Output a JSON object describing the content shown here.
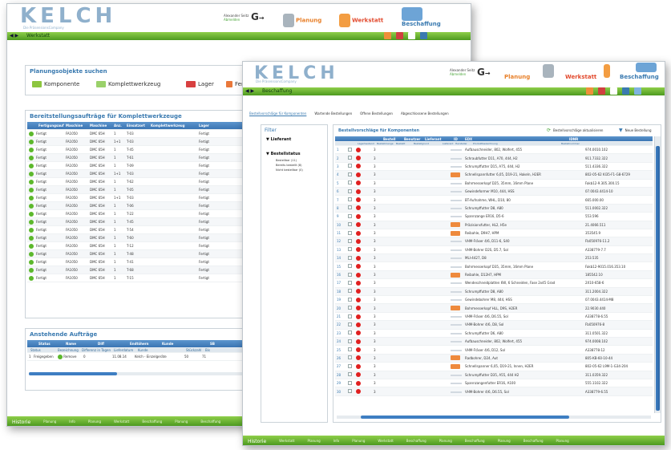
{
  "brand": {
    "logo": "KELCH",
    "tagline": "Die PräsensionsCompany"
  },
  "back_window": {
    "user": {
      "name": "Alexander Seitz",
      "sub": "Abmelden"
    },
    "modules": [
      "Planung",
      "Werkstatt",
      "Beschaffung"
    ],
    "breadcrumb": "Werkstatt",
    "search_panel": {
      "title": "Planungsobjekte suchen",
      "buttons": [
        "Komponente",
        "Komplettwerkzeug",
        "Lager",
        "Fert"
      ]
    },
    "orders_panel": {
      "title": "Bereitstellungsaufträge für Komplettwerkzeuge",
      "columns": [
        "Fertigungsauftrag",
        "Maschine",
        "Maschine",
        "Anz.",
        "Einsatzort",
        "Komplettwerkzeug",
        "Lager"
      ],
      "rows": [
        [
          "Fertigt",
          "FA1050",
          "DMC 65H",
          "1",
          "T-03",
          "",
          "Fertigt"
        ],
        [
          "Fertigt",
          "FA1050",
          "DMC 65H",
          "1+1",
          "T-03",
          "",
          "Fertigt"
        ],
        [
          "Fertigt",
          "FA1050",
          "DMC 65H",
          "1",
          "T-45",
          "",
          "Fertigt"
        ],
        [
          "Fertigt",
          "FA1050",
          "DMC 65H",
          "1",
          "T-61",
          "",
          "Fertigt"
        ],
        [
          "Fertigt",
          "FA1050",
          "DMC 65H",
          "1",
          "T-09",
          "",
          "Fertigt"
        ],
        [
          "Fertigt",
          "FA1050",
          "DMC 65H",
          "1+1",
          "T-03",
          "",
          "Fertigt"
        ],
        [
          "Fertigt",
          "FA1050",
          "DMC 65H",
          "1",
          "T-62",
          "",
          "Fertigt"
        ],
        [
          "Fertigt",
          "FA1050",
          "DMC 65H",
          "1",
          "T-05",
          "",
          "Fertigt"
        ],
        [
          "Fertigt",
          "FA1050",
          "DMC 65H",
          "1+1",
          "T-03",
          "",
          "Fertigt"
        ],
        [
          "Fertigt",
          "FA1050",
          "DMC 65H",
          "1",
          "T-06",
          "",
          "Fertigt"
        ],
        [
          "Fertigt",
          "FA1050",
          "DMC 65H",
          "1",
          "T-22",
          "",
          "Fertigt"
        ],
        [
          "Fertigt",
          "FA1050",
          "DMC 65H",
          "1",
          "T-45",
          "",
          "Fertigt"
        ],
        [
          "Fertigt",
          "FA1050",
          "DMC 65H",
          "1",
          "T-54",
          "",
          "Fertigt"
        ],
        [
          "Fertigt",
          "FA1050",
          "DMC 65H",
          "1",
          "T-60",
          "",
          "Fertigt"
        ],
        [
          "Fertigt",
          "FA1050",
          "DMC 65H",
          "1",
          "T-12",
          "",
          "Fertigt"
        ],
        [
          "Fertigt",
          "FA1050",
          "DMC 65H",
          "1",
          "T-48",
          "",
          "Fertigt"
        ],
        [
          "Fertigt",
          "FA1050",
          "DMC 65H",
          "1",
          "T-41",
          "",
          "Fertigt"
        ],
        [
          "Fertigt",
          "FA1050",
          "DMC 65H",
          "1",
          "T-68",
          "",
          "Fertigt"
        ],
        [
          "Fertigt",
          "FA1050",
          "DMC 65H",
          "1",
          "T-15",
          "",
          "Fertigt"
        ]
      ]
    },
    "pending_panel": {
      "title": "Anstehende Aufträge",
      "columns": [
        "Status",
        "Name",
        "Diff",
        "Endtöhern",
        "Kunde",
        "SB"
      ],
      "subcolumns": [
        "Status",
        "Bezeichnung",
        "Differenz in Tagen",
        "Lieferdatum",
        "Kunde",
        "Stückzahl",
        "Bis"
      ],
      "row": [
        "1",
        "Freigegeben",
        "Remove",
        "0",
        "11.08.14",
        "Kelch - Einzelgeräte",
        "50",
        "71"
      ]
    },
    "footer": [
      "Historie",
      "Planung",
      "Info",
      "Planung",
      "Werkstatt",
      "Beschaffung",
      "Planung",
      "Beschaffung"
    ]
  },
  "front_window": {
    "user": {
      "name": "Alexander Seitz",
      "sub": "Abmelden"
    },
    "modules": [
      "Planung",
      "Werkstatt",
      "Beschaffung"
    ],
    "breadcrumb": "Beschaffung",
    "tabs": [
      "Bestellvorschläge für Komponenten",
      "Wartende Bestellungen",
      "Offene Bestellungen",
      "Abgeschlossene Bestellungen"
    ],
    "filter": {
      "title": "Filter",
      "group1": "Lieferant",
      "group2": "Bestellstatus",
      "options": [
        "Bestellbar (11)",
        "Bereits bestellt (8)",
        "Nicht bestellbar (0)"
      ]
    },
    "table": {
      "title": "Bestellvorschläge für Komponenten",
      "action1": "Bestellvorschläge aktualisieren",
      "action2": "Neue Bestellung",
      "columns": [
        "Bestell",
        "Benutzer",
        "Lieferant",
        "ID",
        "EDX",
        "IDNR"
      ],
      "subcolumns": [
        "Lagerbestand",
        "Bestellmenge",
        "Bestellt",
        "Bestellgrund",
        "Lieferant",
        "Hersteller",
        "Produktbezeichnung",
        "Bestellnummer"
      ],
      "rows": [
        {
          "n": "1",
          "qty": "3",
          "desc": "Aufbauschneider, 802, Wolfert, 455",
          "nr": "974.0010.102",
          "badge": false
        },
        {
          "n": "2",
          "qty": "3",
          "desc": "Schraubfutter D11, A70, 444, H2",
          "nr": "911.7332.322",
          "badge": false
        },
        {
          "n": "3",
          "qty": "3",
          "desc": "Schrumpffutter D15, A75, 444, H2",
          "nr": "511.4336.322",
          "badge": false
        },
        {
          "n": "4",
          "qty": "3",
          "desc": "Schnellspannfutter 6,05, D19-21, Hakeln, H2ER",
          "nr": "802-05-62 Kl35-F1-G8-6729",
          "badge": true
        },
        {
          "n": "5",
          "qty": "3",
          "desc": "Bohrmesserkopf D25, 35mm, 16mm Plane",
          "nr": "Fakb12-9.305.300.15",
          "badge": false
        },
        {
          "n": "6",
          "qty": "3",
          "desc": "Gewindeformer M10, 444, HSS",
          "nr": "07.0043.4414-10",
          "badge": false
        },
        {
          "n": "7",
          "qty": "3",
          "desc": "BT-Aufnahme, WHL, D10, 80",
          "nr": "665.000.00",
          "badge": false
        },
        {
          "n": "8",
          "qty": "3",
          "desc": "Schrumpffutter D8, A80",
          "nr": "511.0002.322",
          "badge": false
        },
        {
          "n": "9",
          "qty": "3",
          "desc": "Spannzange ER16, D5-6",
          "nr": "553.596",
          "badge": false
        },
        {
          "n": "10",
          "qty": "3",
          "desc": "Präzisionsfutter, HL2, H5e",
          "nr": "21.4066.511",
          "badge": true
        },
        {
          "n": "11",
          "qty": "3",
          "desc": "Reibahle, D9H7, HPM",
          "nr": "353545.9",
          "badge": true
        },
        {
          "n": "12",
          "qty": "3",
          "desc": "VHM-Fräser 4/6, D11-6, S40",
          "nr": "Fb050976-11.2",
          "badge": false
        },
        {
          "n": "13",
          "qty": "3",
          "desc": "VHM-Bohrer D2S, D5.7, Sol",
          "nr": "A338779-7.7",
          "badge": false
        },
        {
          "n": "14",
          "qty": "3",
          "desc": "MLI-4427, D8",
          "nr": "253.535",
          "badge": false
        },
        {
          "n": "15",
          "qty": "3",
          "desc": "Bohrmesserkopf D35, 35mm, 16mm Plane",
          "nr": "Fakb12-9015.016.353.10",
          "badge": false
        },
        {
          "n": "16",
          "qty": "3",
          "desc": "Reibahle, D12H7, HPM",
          "nr": "185542.10",
          "badge": true
        },
        {
          "n": "17",
          "qty": "3",
          "desc": "Wendeschneidplatten 6W, 6 Schneiden, Fase 2x45 Grad",
          "nr": "2X10-658-6",
          "badge": false
        },
        {
          "n": "18",
          "qty": "3",
          "desc": "Schrumpffutter D8, A80",
          "nr": "311.2004.322",
          "badge": false
        },
        {
          "n": "19",
          "qty": "3",
          "desc": "Gewindebohrer M8, 444, HSS",
          "nr": "07.0043.4414-M8",
          "badge": false
        },
        {
          "n": "20",
          "qty": "3",
          "desc": "Bohrmesserkopf HLL, D9S, H2ER",
          "nr": "22.9030.440",
          "badge": true
        },
        {
          "n": "21",
          "qty": "3",
          "desc": "VHM-Fräser 4/6, D6.55, Sol",
          "nr": "A338778-6.55",
          "badge": false
        },
        {
          "n": "22",
          "qty": "3",
          "desc": "VHM-Bohrer 4/6, D8, Sol",
          "nr": "Fb050976-8",
          "badge": false
        },
        {
          "n": "23",
          "qty": "3",
          "desc": "Schrumpffutter D6, A80",
          "nr": "311.0501.322",
          "badge": false
        },
        {
          "n": "24",
          "qty": "3",
          "desc": "Aufbauschneider, 802, Wolfert, 455",
          "nr": "974.0008.102",
          "badge": false
        },
        {
          "n": "25",
          "qty": "3",
          "desc": "VHM-Fräser 4/6, D12, Sol",
          "nr": "A338778-12",
          "badge": false
        },
        {
          "n": "26",
          "qty": "3",
          "desc": "Radbohrer, D24, Aut",
          "nr": "805-KB-60-10-44",
          "badge": true
        },
        {
          "n": "27",
          "qty": "3",
          "desc": "Schnellspanner 6,05, D19-21, Innen, H2ER",
          "nr": "802-05-62 L9M-1-G34-204",
          "badge": true
        },
        {
          "n": "28",
          "qty": "3",
          "desc": "Schrumpffutter D35, A55, 444 H2",
          "nr": "311.0359.322",
          "badge": false
        },
        {
          "n": "29",
          "qty": "3",
          "desc": "Spannzangenfutter ER16, A100",
          "nr": "555.1102.322",
          "badge": false
        },
        {
          "n": "30",
          "qty": "3",
          "desc": "VHM-Bohrer 4/6, D6.55, Sol",
          "nr": "A338779-6.55",
          "badge": false
        }
      ]
    },
    "footer": [
      "Historie",
      "Werkstatt",
      "Planung",
      "Info",
      "Planung",
      "Werkstatt",
      "Beschaffung",
      "Planung",
      "Beschaffung",
      "Planung",
      "Beschaffung",
      "Planung"
    ]
  }
}
